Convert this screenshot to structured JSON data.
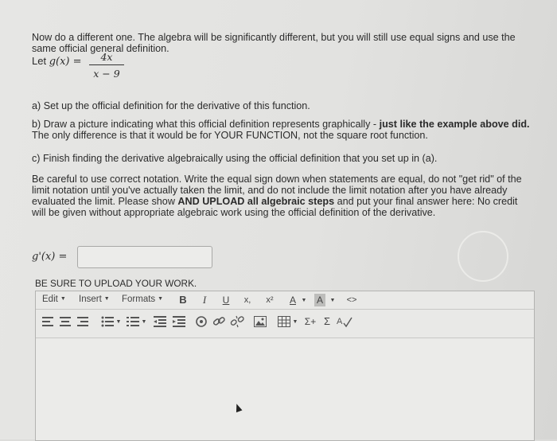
{
  "intro": "Now do a different one. The algebra will be significantly different, but you will still use equal signs and use the same official general definition.",
  "function_def": {
    "prefix": "Let ",
    "lhs": "g(x) =",
    "numerator": "4x",
    "denominator": "x − 9"
  },
  "questions": {
    "a": "a) Set up the official definition for the derivative of this function.",
    "b_prefix": "b) Draw a picture indicating what this official definition represents graphically - ",
    "b_bold": "just like the example above did.",
    "b_rest": " The only difference is that it would be for YOUR FUNCTION, not the square root function.",
    "c": "c) Finish finding the derivative algebraically using the official definition that you set up in (a)."
  },
  "instructions": {
    "part1": "Be careful to use correct notation. Write the equal sign down when statements are equal, do not \"get rid\" of the limit notation until you've actually taken the limit, and do not include the limit notation after you have already evaluated the limit. Please show ",
    "bold": "AND UPLOAD all algebraic steps",
    "part2": " and put your final answer here: No credit will be given without appropriate algebraic work using the official definition of the derivative."
  },
  "answer": {
    "label": "g'(x) =",
    "value": ""
  },
  "upload_label": "BE SURE TO UPLOAD YOUR WORK.",
  "editor": {
    "menus": [
      "Edit",
      "Insert",
      "Formats"
    ],
    "format_buttons": {
      "bold": "B",
      "italic": "I",
      "underline": "U",
      "subscript": "x,",
      "superscript": "x²",
      "text_color": "A",
      "highlight": "A",
      "code": "<>",
      "sigma_insert": "Σ+",
      "sigma": "Σ"
    }
  },
  "colors": {
    "page_bg": "#e4e4e2",
    "text": "#2b2b2b",
    "border": "#a9a9a7"
  }
}
